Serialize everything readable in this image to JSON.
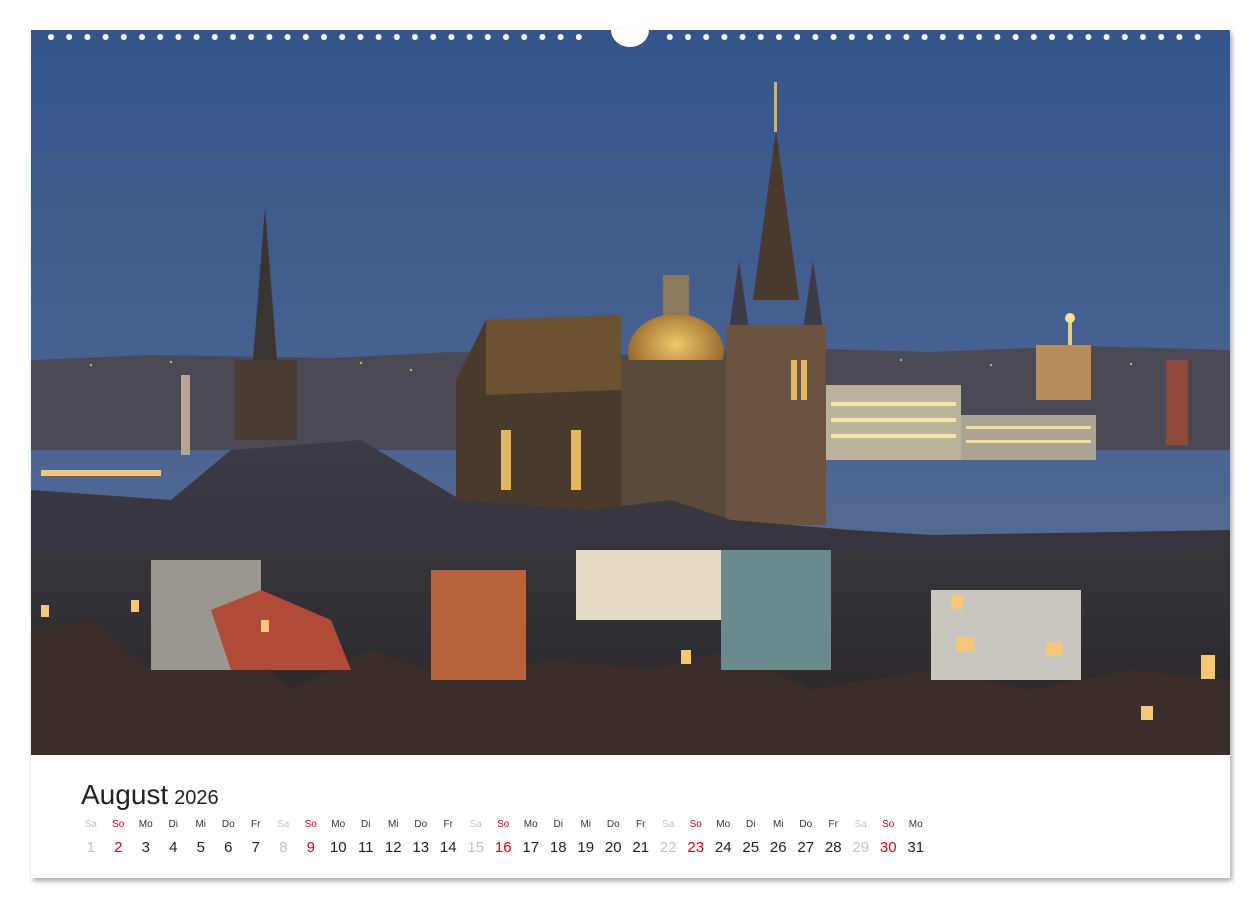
{
  "photo": {
    "subject": "Aachen skyline at dusk with cathedral"
  },
  "calendar": {
    "month": "August",
    "year": "2026",
    "days": [
      {
        "wd": "Sa",
        "d": "1",
        "type": "sat"
      },
      {
        "wd": "So",
        "d": "2",
        "type": "sun"
      },
      {
        "wd": "Mo",
        "d": "3",
        "type": "week"
      },
      {
        "wd": "Di",
        "d": "4",
        "type": "week"
      },
      {
        "wd": "Mi",
        "d": "5",
        "type": "week"
      },
      {
        "wd": "Do",
        "d": "6",
        "type": "week"
      },
      {
        "wd": "Fr",
        "d": "7",
        "type": "week"
      },
      {
        "wd": "Sa",
        "d": "8",
        "type": "sat"
      },
      {
        "wd": "So",
        "d": "9",
        "type": "sun"
      },
      {
        "wd": "Mo",
        "d": "10",
        "type": "week"
      },
      {
        "wd": "Di",
        "d": "11",
        "type": "week"
      },
      {
        "wd": "Mi",
        "d": "12",
        "type": "week"
      },
      {
        "wd": "Do",
        "d": "13",
        "type": "week"
      },
      {
        "wd": "Fr",
        "d": "14",
        "type": "week"
      },
      {
        "wd": "Sa",
        "d": "15",
        "type": "sat"
      },
      {
        "wd": "So",
        "d": "16",
        "type": "sun"
      },
      {
        "wd": "Mo",
        "d": "17",
        "type": "week"
      },
      {
        "wd": "Di",
        "d": "18",
        "type": "week"
      },
      {
        "wd": "Mi",
        "d": "19",
        "type": "week"
      },
      {
        "wd": "Do",
        "d": "20",
        "type": "week"
      },
      {
        "wd": "Fr",
        "d": "21",
        "type": "week"
      },
      {
        "wd": "Sa",
        "d": "22",
        "type": "sat"
      },
      {
        "wd": "So",
        "d": "23",
        "type": "sun"
      },
      {
        "wd": "Mo",
        "d": "24",
        "type": "week"
      },
      {
        "wd": "Di",
        "d": "25",
        "type": "week"
      },
      {
        "wd": "Mi",
        "d": "26",
        "type": "week"
      },
      {
        "wd": "Do",
        "d": "27",
        "type": "week"
      },
      {
        "wd": "Fr",
        "d": "28",
        "type": "week"
      },
      {
        "wd": "Sa",
        "d": "29",
        "type": "sat"
      },
      {
        "wd": "So",
        "d": "30",
        "type": "sun"
      },
      {
        "wd": "Mo",
        "d": "31",
        "type": "week"
      }
    ]
  },
  "colors": {
    "sunday": "#d0021b",
    "saturday": "#c4c4c4",
    "sky_top": "#3a5a8e",
    "sky_bottom": "#5b6f93"
  }
}
